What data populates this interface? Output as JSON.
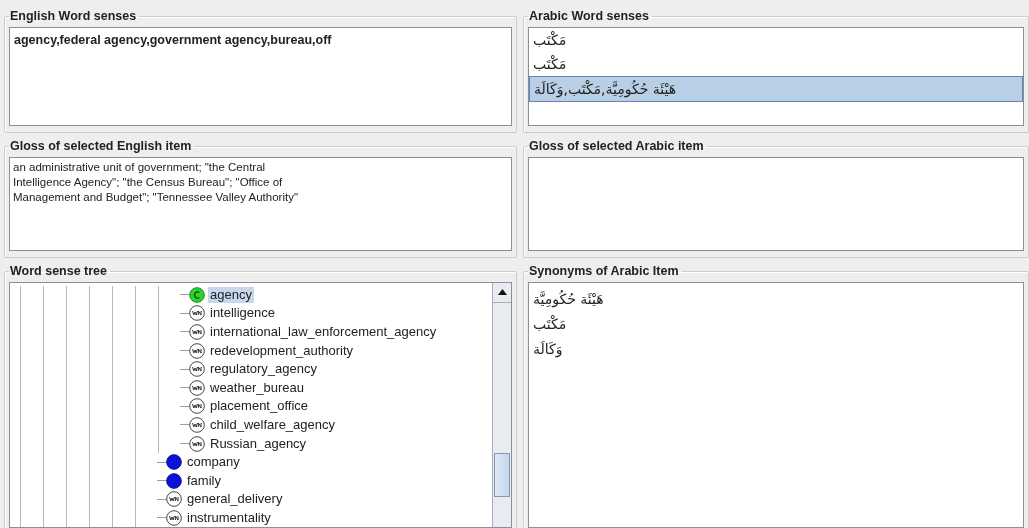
{
  "english_senses": {
    "title": "English Word senses",
    "items": [
      {
        "text": "agency,federal agency,government agency,bureau,off"
      }
    ]
  },
  "arabic_senses": {
    "title": "Arabic Word senses",
    "items": [
      {
        "text": "مَكْتَب",
        "selected": false
      },
      {
        "text": "مَكْتَب",
        "selected": false
      },
      {
        "text": "هَيْئَة حُكُومِيَّة,مَكْتَب,وَكَالَة",
        "selected": true
      }
    ]
  },
  "english_gloss": {
    "title": "Gloss of selected English item",
    "text": "an administrative unit of government; \"the Central Intelligence Agency\"; \"the Census Bureau\"; \"Office of Management and Budget\"; \"Tennessee Valley Authority\""
  },
  "arabic_gloss": {
    "title": "Gloss of selected Arabic item"
  },
  "sense_tree": {
    "title": "Word sense tree",
    "nodes": [
      {
        "children": [
          {
            "label": "agency",
            "kind": "concept",
            "selected": true
          },
          {
            "label": "intelligence",
            "kind": "wordnet",
            "selected": false
          },
          {
            "label": "international_law_enforcement_agency",
            "kind": "wordnet",
            "selected": false
          },
          {
            "label": "redevelopment_authority",
            "kind": "wordnet",
            "selected": false
          },
          {
            "label": "regulatory_agency",
            "kind": "wordnet",
            "selected": false
          },
          {
            "label": "weather_bureau",
            "kind": "wordnet",
            "selected": false
          },
          {
            "label": "placement_office",
            "kind": "wordnet",
            "selected": false
          },
          {
            "label": "child_welfare_agency",
            "kind": "wordnet",
            "selected": false
          },
          {
            "label": "Russian_agency",
            "kind": "wordnet",
            "selected": false
          }
        ]
      },
      {
        "label": "company",
        "kind": "group",
        "selected": false
      },
      {
        "label": "family",
        "kind": "group",
        "selected": false
      },
      {
        "label": "general_delivery",
        "kind": "wordnet",
        "selected": false
      },
      {
        "label": "instrumentality",
        "kind": "wordnet",
        "selected": false
      }
    ]
  },
  "arabic_synonyms": {
    "title": "Synonyms of Arabic Item",
    "items": [
      "هَيْئَة حُكُومِيَّة",
      "مَكْتَب",
      "وَكَالَة"
    ]
  }
}
